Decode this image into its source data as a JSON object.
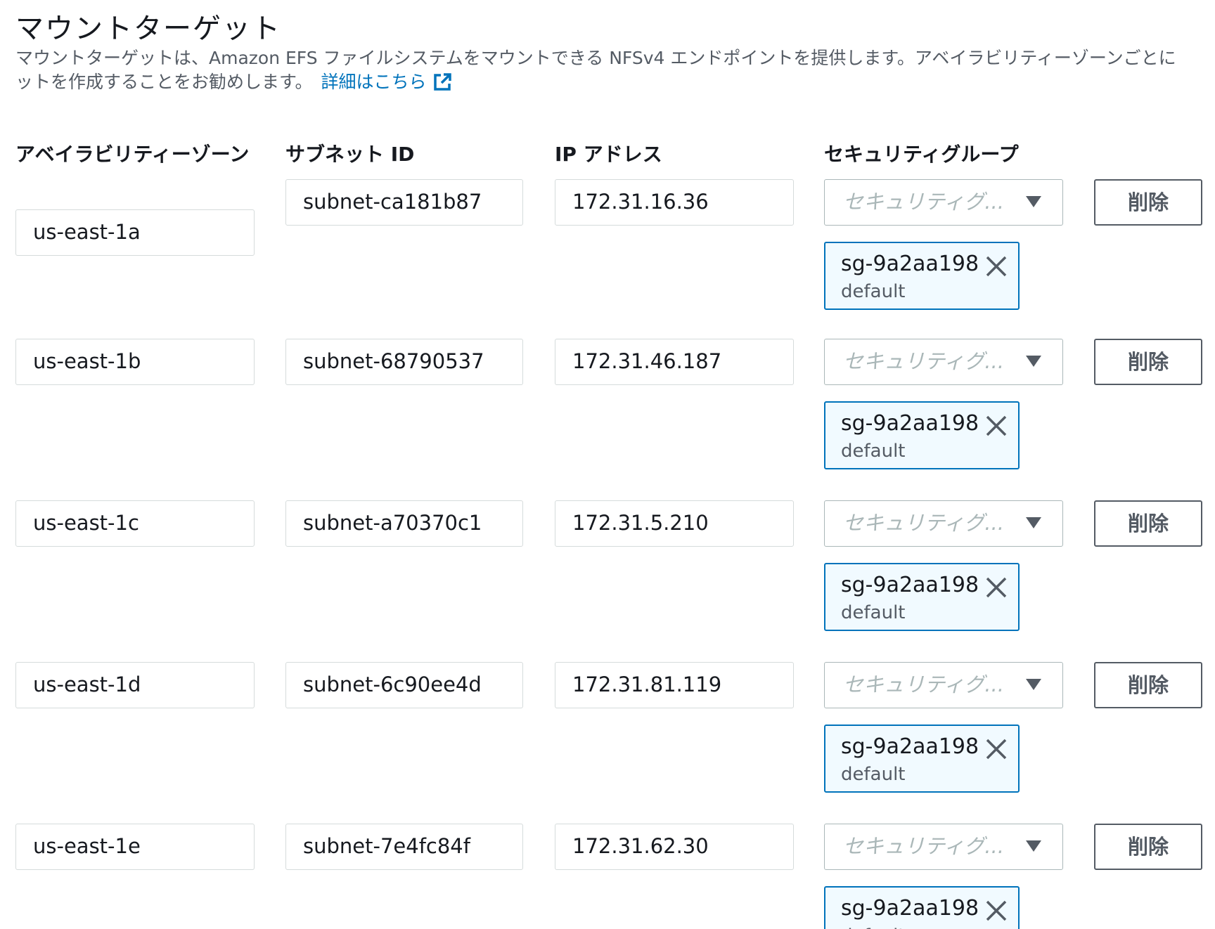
{
  "section": {
    "title": "マウントターゲット",
    "description_line1": "マウントターゲットは、Amazon EFS ファイルシステムをマウントできる NFSv4 エンドポイントを提供します。アベイラビリティーゾーンごとに",
    "description_line2": "ットを作成することをお勧めします。",
    "learn_more": "詳細はこちら"
  },
  "columns": {
    "az": "アベイラビリティーゾーン",
    "subnet": "サブネット ID",
    "ip": "IP アドレス",
    "sg": "セキュリティグループ"
  },
  "rows": [
    {
      "az": "us-east-1a",
      "subnet": "subnet-ca181b87",
      "ip": "172.31.16.36",
      "sg_placeholder": "セキュリティグ...",
      "sg_id": "sg-9a2aa198",
      "sg_name": "default",
      "delete_label": "削除"
    },
    {
      "az": "us-east-1b",
      "subnet": "subnet-68790537",
      "ip": "172.31.46.187",
      "sg_placeholder": "セキュリティグ...",
      "sg_id": "sg-9a2aa198",
      "sg_name": "default",
      "delete_label": "削除"
    },
    {
      "az": "us-east-1c",
      "subnet": "subnet-a70370c1",
      "ip": "172.31.5.210",
      "sg_placeholder": "セキュリティグ...",
      "sg_id": "sg-9a2aa198",
      "sg_name": "default",
      "delete_label": "削除"
    },
    {
      "az": "us-east-1d",
      "subnet": "subnet-6c90ee4d",
      "ip": "172.31.81.119",
      "sg_placeholder": "セキュリティグ...",
      "sg_id": "sg-9a2aa198",
      "sg_name": "default",
      "delete_label": "削除"
    },
    {
      "az": "us-east-1e",
      "subnet": "subnet-7e4fc84f",
      "ip": "172.31.62.30",
      "sg_placeholder": "セキュリティグ...",
      "sg_id": "sg-9a2aa198",
      "sg_name": "default",
      "delete_label": "削除"
    }
  ],
  "colors": {
    "link": "#0073bb",
    "token_border": "#0073bb",
    "token_bg": "#f1faff"
  },
  "icons": {
    "learn_more": "external-link-icon",
    "select": "caret-down-icon",
    "token": "close-icon"
  }
}
